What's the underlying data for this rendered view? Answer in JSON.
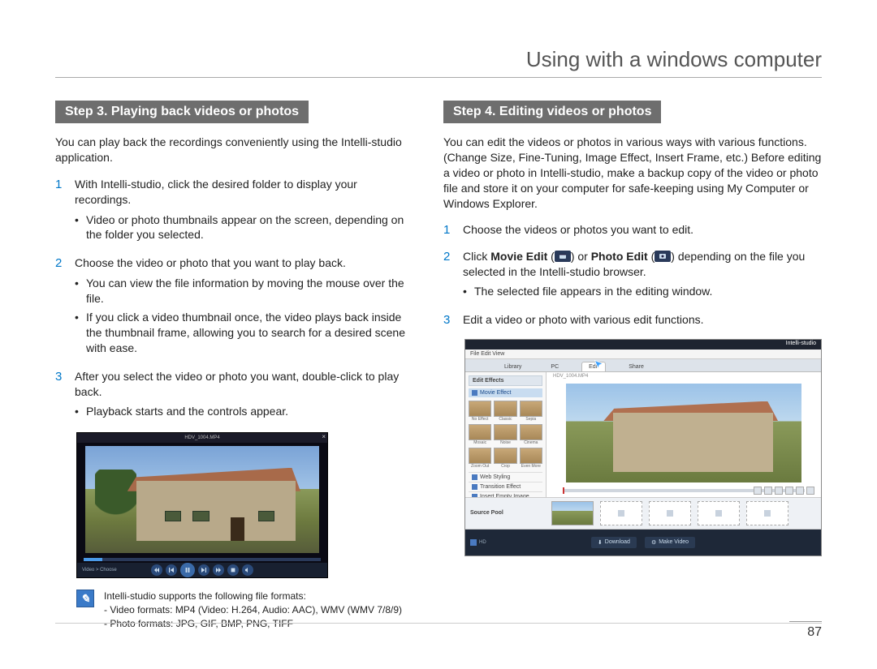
{
  "page": {
    "title": "Using with a windows computer",
    "number": "87"
  },
  "left": {
    "heading": "Step 3. Playing back videos or photos",
    "intro": "You can play back the recordings conveniently using the Intelli-studio application.",
    "steps": [
      {
        "num": "1",
        "text": "With Intelli-studio, click the desired folder to display your recordings.",
        "sub": [
          "Video or photo thumbnails appear on the screen, depending on the folder you selected."
        ]
      },
      {
        "num": "2",
        "text": "Choose the video or photo that you want to play back.",
        "sub": [
          "You can view the file information by moving the mouse over the file.",
          "If you click a video thumbnail once, the video plays back inside the thumbnail frame, allowing you to search for a desired scene with ease."
        ]
      },
      {
        "num": "3",
        "text": "After you select the video or photo you want, double-click to play back.",
        "sub": [
          "Playback starts and the controls appear."
        ]
      }
    ],
    "playback": {
      "filename": "HDV_1004.MP4",
      "bottom_left": "Video > Choose"
    },
    "note": {
      "lines": [
        "Intelli-studio supports the following file formats:",
        "- Video formats: MP4 (Video: H.264, Audio: AAC), WMV (WMV 7/8/9)",
        "- Photo formats: JPG, GIF, BMP, PNG, TIFF"
      ]
    }
  },
  "right": {
    "heading": "Step 4. Editing videos or photos",
    "intro": "You can edit the videos or photos in various ways with various functions. (Change Size, Fine-Tuning, Image Effect, Insert Frame, etc.) Before editing a video or photo in Intelli-studio, make a backup copy of the video or photo file and store it on your computer for safe-keeping using My Computer or Windows Explorer.",
    "steps": [
      {
        "num": "1",
        "text": "Choose the videos or photos you want to edit."
      },
      {
        "num": "2",
        "pre": "Click ",
        "movie_edit": "Movie Edit",
        "or": " or ",
        "photo_edit": "Photo Edit",
        "post": " depending on the file you selected in the Intelli-studio browser.",
        "sub": [
          "The selected file appears in the editing window."
        ]
      },
      {
        "num": "3",
        "text": "Edit a video or photo with various edit functions."
      }
    ],
    "editor": {
      "logo": "Intelli-studio",
      "menu": "File  Edit  View",
      "tabs": [
        "Library",
        "PC",
        "Edit",
        "Share"
      ],
      "active_tab": 2,
      "filename": "HDV_1004.MP4",
      "side_heading": "Edit Effects",
      "movie_effect": "Movie Effect",
      "thumb_labels": [
        "No Effect",
        "Classic",
        "Sepia",
        "Mosaic",
        "Noise",
        "Cinema",
        "Zoom Out",
        "Crop",
        "Even More"
      ],
      "options": [
        "Web Styling",
        "Transition Effect",
        "Insert Empty Image"
      ],
      "strip_heading": "Source Pool",
      "bottom_buttons": [
        "Download",
        "Make Video"
      ],
      "bottom_left": "HD"
    }
  }
}
